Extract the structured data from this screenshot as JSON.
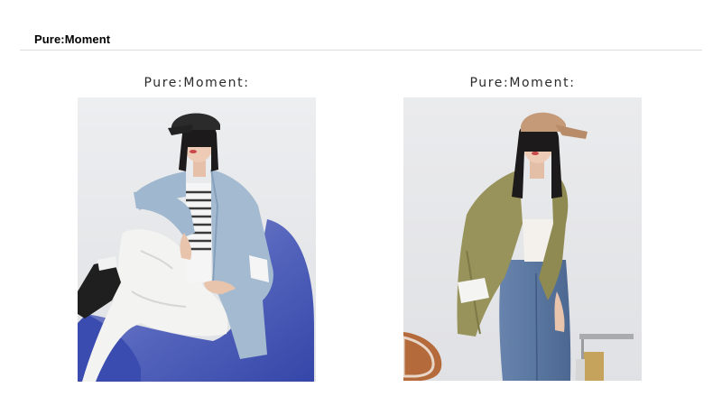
{
  "header": {
    "title": "Pure:Moment"
  },
  "photos": [
    {
      "caption": "Pure:Moment:",
      "subject": "model in light blue blazer seated on blue chair"
    },
    {
      "caption": "Pure:Moment:",
      "subject": "model in olive blazer, beige cap and denim jeans"
    }
  ],
  "colors": {
    "background": "#ffffff",
    "divider": "#dcdcdc",
    "studio_wall": "#e6e7e9",
    "blue_blazer": "#9fb7cf",
    "blue_chair": "#4c5fb8",
    "olive_blazer": "#97925a",
    "denim": "#5a7aa3",
    "cap_tan": "#c49a78"
  }
}
